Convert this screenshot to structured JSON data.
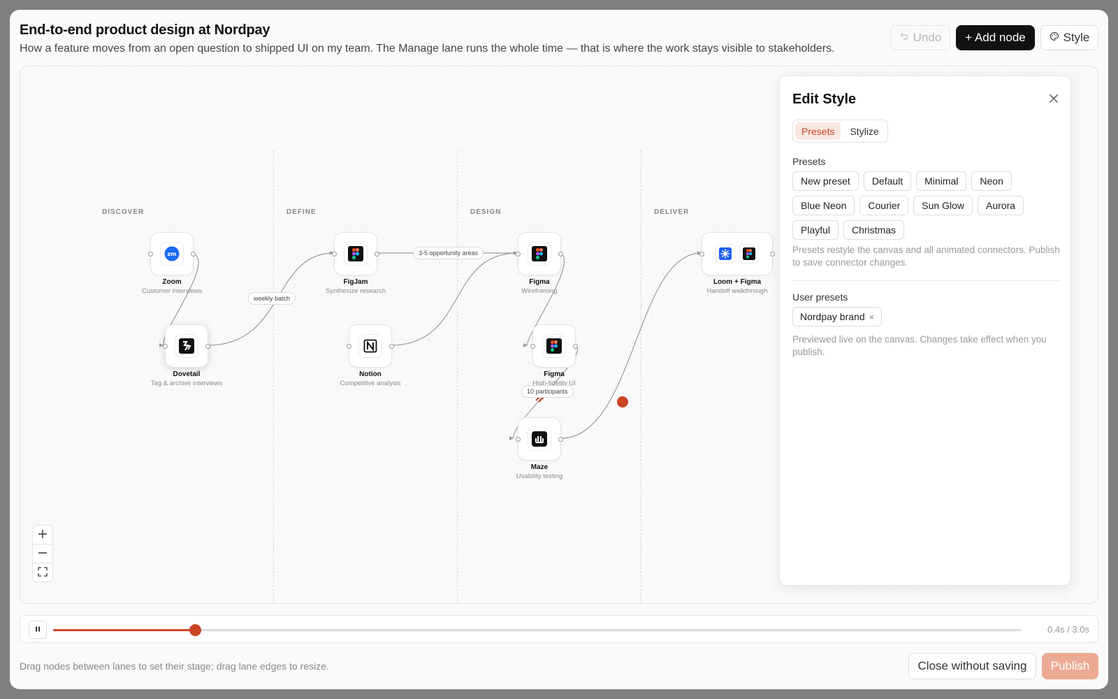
{
  "header": {
    "title": "End-to-end product design at Nordpay",
    "subtitle": "How a feature moves from an open question to shipped UI on my team. The Manage lane runs the whole time — that is where the work stays visible to stakeholders.",
    "undo_label": "Undo",
    "add_node_label": "+ Add node",
    "style_label": "Style"
  },
  "lanes": [
    "DISCOVER",
    "DEFINE",
    "DESIGN",
    "DELIVER"
  ],
  "nodes": [
    {
      "name": "Zoom",
      "desc": "Customer interviews",
      "icon": "zoom-icon"
    },
    {
      "name": "Dovetail",
      "desc": "Tag & archive interviews",
      "icon": "dovetail-icon"
    },
    {
      "name": "FigJam",
      "desc": "Synthesize research",
      "icon": "figjam-icon"
    },
    {
      "name": "Notion",
      "desc": "Competitive analysis",
      "icon": "notion-icon"
    },
    {
      "name": "Figma",
      "desc": "Wireframing",
      "icon": "figma-icon"
    },
    {
      "name": "Figma",
      "desc": "High-fidelity UI",
      "icon": "figma-icon"
    },
    {
      "name": "Maze",
      "desc": "Usability testing",
      "icon": "maze-icon"
    },
    {
      "name": "Loom + Figma",
      "desc": "Handoff walkthrough",
      "icon": "loom-icon"
    }
  ],
  "edge_labels": [
    "weekly batch",
    "3-5 opportunity areas",
    "10 participants"
  ],
  "panel": {
    "title": "Edit Style",
    "tabs": [
      "Presets",
      "Stylize"
    ],
    "presets_label": "Presets",
    "presets": [
      "New preset",
      "Default",
      "Minimal",
      "Neon",
      "Blue Neon",
      "Courier",
      "Sun Glow",
      "Aurora",
      "Playful",
      "Christmas"
    ],
    "presets_note": "Presets restyle the canvas and all animated connectors. Publish to save connector changes.",
    "user_presets_label": "User presets",
    "user_presets": [
      "Nordpay brand"
    ],
    "user_note": "Previewed live on the canvas. Changes take effect when you publish."
  },
  "timeline": {
    "time": "0.4s / 3.0s",
    "progress": 0.1467
  },
  "footer": {
    "note": "Drag nodes between lanes to set their stage; drag lane edges to resize.",
    "close_label": "Close without saving",
    "publish_label": "Publish"
  },
  "colors": {
    "accent": "#c94424",
    "publish_disabled": "#ecaa94",
    "primary_button": "#111111"
  }
}
